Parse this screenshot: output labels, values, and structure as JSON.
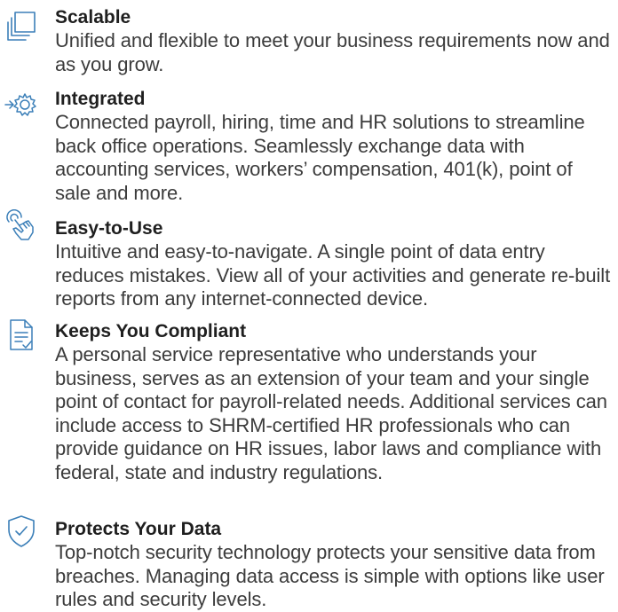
{
  "features": [
    {
      "title": "Scalable",
      "description": "Unified and flexible to meet your business requirements now and as you grow.",
      "icon": "scalable-icon"
    },
    {
      "title": "Integrated",
      "description": "Connected payroll, hiring, time and HR solutions to streamline back office operations. Seamlessly exchange data with accounting services, workers’ compensation, 401(k), point of sale and more.",
      "icon": "integration-gear-icon"
    },
    {
      "title": "Easy-to-Use",
      "description": "Intuitive and easy-to-navigate. A single point of data entry reduces mistakes. View all of your activities and generate re-built reports from any internet-connected device.",
      "icon": "pointer-hand-icon"
    },
    {
      "title": "Keeps You Compliant",
      "description": "A personal service representative who understands your business, serves as an extension of your team and your single point of contact for payroll-related needs. Additional services can include access to SHRM-certified HR professionals who can provide guidance on HR issues, labor laws and compliance with federal, state and industry regulations.",
      "icon": "document-check-icon"
    },
    {
      "title": "Protects Your Data",
      "description": "Top-notch security technology protects your sensitive data from breaches. Managing data access is simple with options like user rules and security levels.",
      "icon": "shield-check-icon"
    }
  ],
  "colors": {
    "icon_stroke": "#3b7fb8",
    "title": "#1f1f1f",
    "body": "#3c3c3c"
  }
}
